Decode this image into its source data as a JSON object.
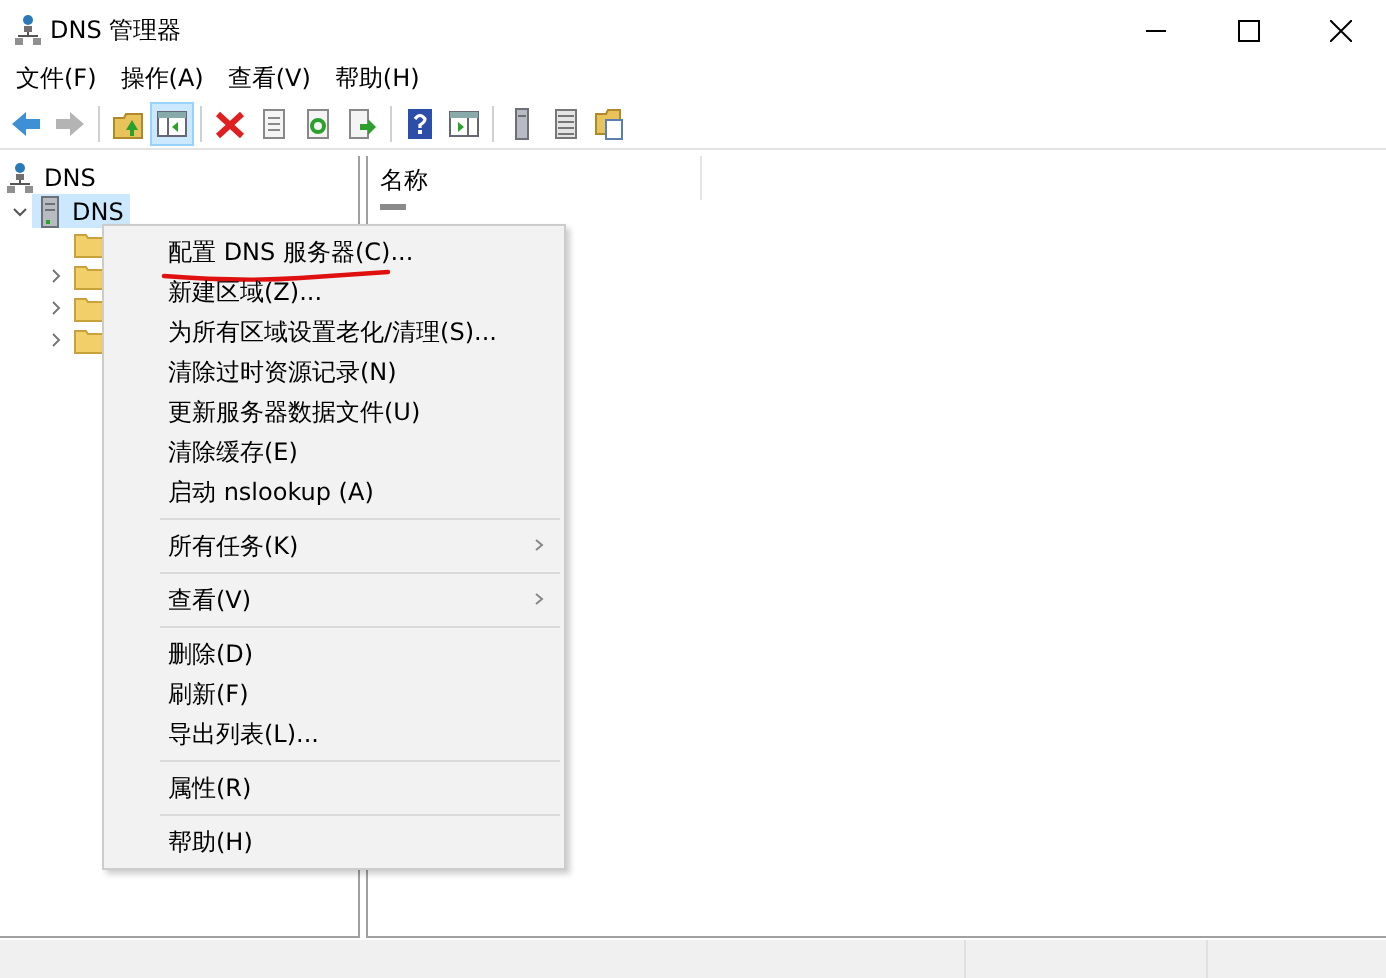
{
  "window": {
    "title": "DNS 管理器"
  },
  "menubar": [
    "文件(F)",
    "操作(A)",
    "查看(V)",
    "帮助(H)"
  ],
  "toolbar": [
    {
      "kind": "back",
      "pressed": false,
      "disabled": false
    },
    {
      "kind": "forward",
      "pressed": false,
      "disabled": true
    },
    {
      "kind": "separator"
    },
    {
      "kind": "up",
      "pressed": false,
      "disabled": false
    },
    {
      "kind": "tree-toggle",
      "pressed": true,
      "disabled": false
    },
    {
      "kind": "separator"
    },
    {
      "kind": "delete",
      "pressed": false,
      "disabled": false
    },
    {
      "kind": "properties",
      "pressed": false,
      "disabled": false
    },
    {
      "kind": "refresh",
      "pressed": false,
      "disabled": false
    },
    {
      "kind": "export",
      "pressed": false,
      "disabled": false
    },
    {
      "kind": "separator"
    },
    {
      "kind": "help",
      "pressed": false,
      "disabled": false
    },
    {
      "kind": "action-pane",
      "pressed": false,
      "disabled": false
    },
    {
      "kind": "separator"
    },
    {
      "kind": "server",
      "pressed": false,
      "disabled": false
    },
    {
      "kind": "list",
      "pressed": false,
      "disabled": false
    },
    {
      "kind": "folder-doc",
      "pressed": false,
      "disabled": false
    }
  ],
  "tree": {
    "label": "DNS",
    "children": [
      {
        "label": "DNS",
        "kind": "server",
        "expanded": true,
        "selected": true,
        "children": [
          {
            "kind": "folder",
            "expandable": false
          },
          {
            "kind": "folder",
            "expandable": true
          },
          {
            "kind": "folder",
            "expandable": true
          },
          {
            "kind": "folder",
            "expandable": true
          }
        ]
      }
    ]
  },
  "list": {
    "columns": [
      "名称"
    ]
  },
  "context_menu": [
    {
      "kind": "item",
      "label": "配置 DNS 服务器(C)...",
      "underlined": true,
      "submenu": false
    },
    {
      "kind": "item",
      "label": "新建区域(Z)...",
      "underlined": false,
      "submenu": false
    },
    {
      "kind": "item",
      "label": "为所有区域设置老化/清理(S)...",
      "underlined": false,
      "submenu": false
    },
    {
      "kind": "item",
      "label": "清除过时资源记录(N)",
      "underlined": false,
      "submenu": false
    },
    {
      "kind": "item",
      "label": "更新服务器数据文件(U)",
      "underlined": false,
      "submenu": false
    },
    {
      "kind": "item",
      "label": "清除缓存(E)",
      "underlined": false,
      "submenu": false
    },
    {
      "kind": "item",
      "label": "启动 nslookup (A)",
      "underlined": false,
      "submenu": false
    },
    {
      "kind": "separator"
    },
    {
      "kind": "item",
      "label": "所有任务(K)",
      "underlined": false,
      "submenu": true
    },
    {
      "kind": "separator"
    },
    {
      "kind": "item",
      "label": "查看(V)",
      "underlined": false,
      "submenu": true
    },
    {
      "kind": "separator"
    },
    {
      "kind": "item",
      "label": "删除(D)",
      "underlined": false,
      "submenu": false
    },
    {
      "kind": "item",
      "label": "刷新(F)",
      "underlined": false,
      "submenu": false
    },
    {
      "kind": "item",
      "label": "导出列表(L)...",
      "underlined": false,
      "submenu": false
    },
    {
      "kind": "separator"
    },
    {
      "kind": "item",
      "label": "属性(R)",
      "underlined": false,
      "submenu": false
    },
    {
      "kind": "separator"
    },
    {
      "kind": "item",
      "label": "帮助(H)",
      "underlined": false,
      "submenu": false
    }
  ]
}
